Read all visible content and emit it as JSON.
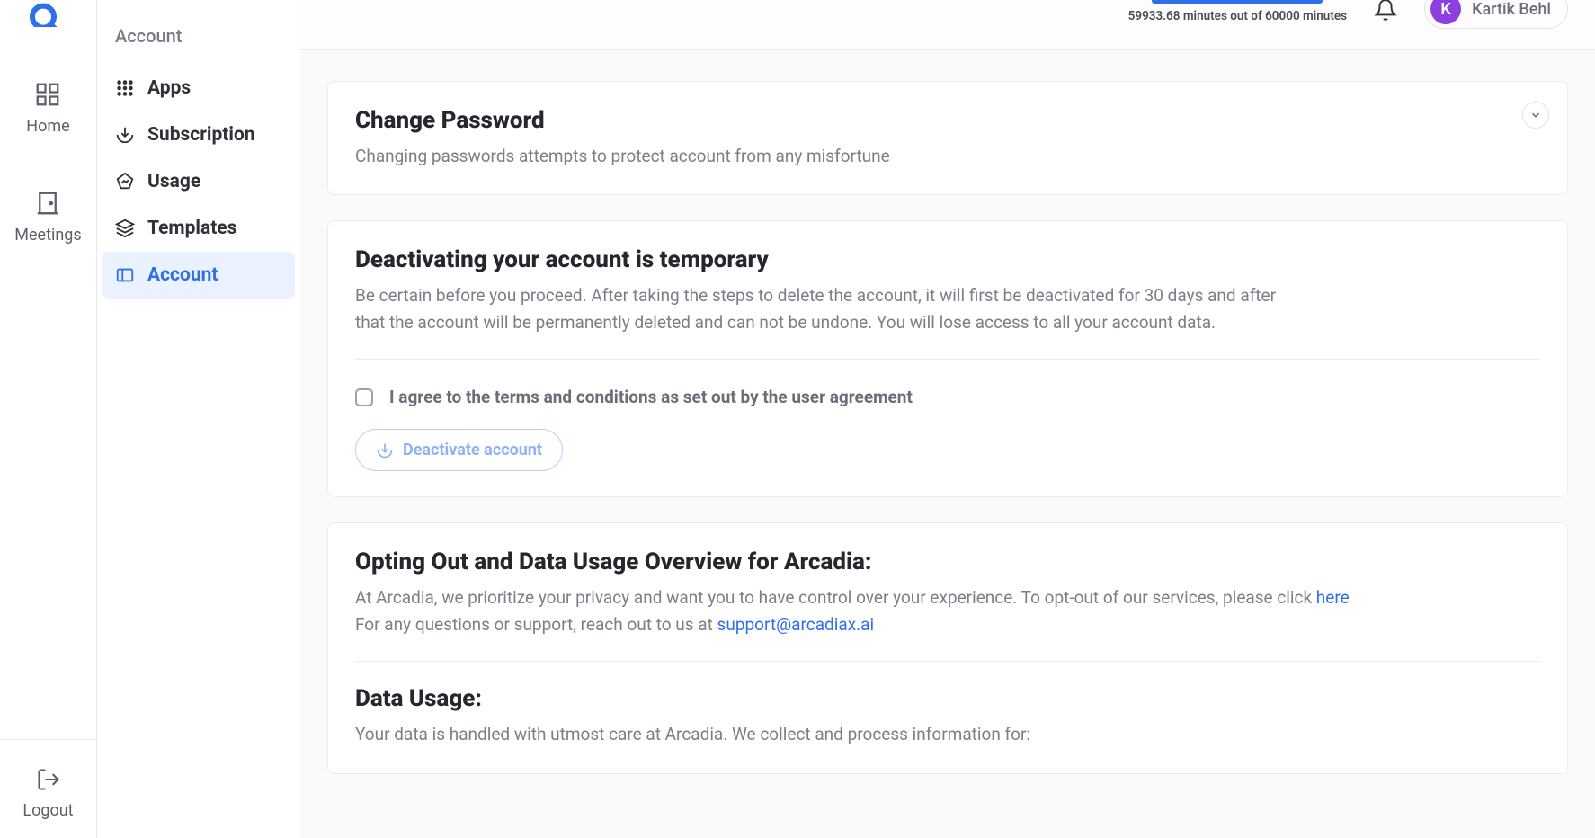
{
  "topbar": {
    "quota_text": "59933.68 minutes out of 60000 minutes",
    "user_initial": "K",
    "user_name": "Kartik Behl"
  },
  "left_rail": {
    "items": [
      {
        "label": "Home"
      },
      {
        "label": "Meetings"
      }
    ],
    "logout": "Logout"
  },
  "sub_sidebar": {
    "title": "Account",
    "items": [
      {
        "label": "Apps"
      },
      {
        "label": "Subscription"
      },
      {
        "label": "Usage"
      },
      {
        "label": "Templates"
      },
      {
        "label": "Account"
      }
    ]
  },
  "cards": {
    "change_password": {
      "title": "Change Password",
      "subtitle": "Changing passwords attempts to protect account from any misfortune"
    },
    "deactivate": {
      "title": "Deactivating your account is temporary",
      "subtitle": "Be certain before you proceed. After taking the steps to delete the account, it will first be deactivated for 30 days and after that the account will be permanently deleted and can not be undone. You will lose access to all your account data.",
      "agree_label": "I agree to the terms and conditions as set out by the user agreement",
      "button_label": "Deactivate account"
    },
    "opt_out": {
      "title": "Opting Out and Data Usage Overview for Arcadia:",
      "line1_pre": "At Arcadia, we prioritize your privacy and want you to have control over your experience. To opt-out of our services, please click ",
      "line1_link": "here",
      "line2_pre": "For any questions or support, reach out to us at ",
      "line2_link": "support@arcadiax.ai",
      "data_usage_title": "Data Usage:",
      "data_usage_sub": "Your data is handled with utmost care at Arcadia. We collect and process information for:"
    }
  }
}
